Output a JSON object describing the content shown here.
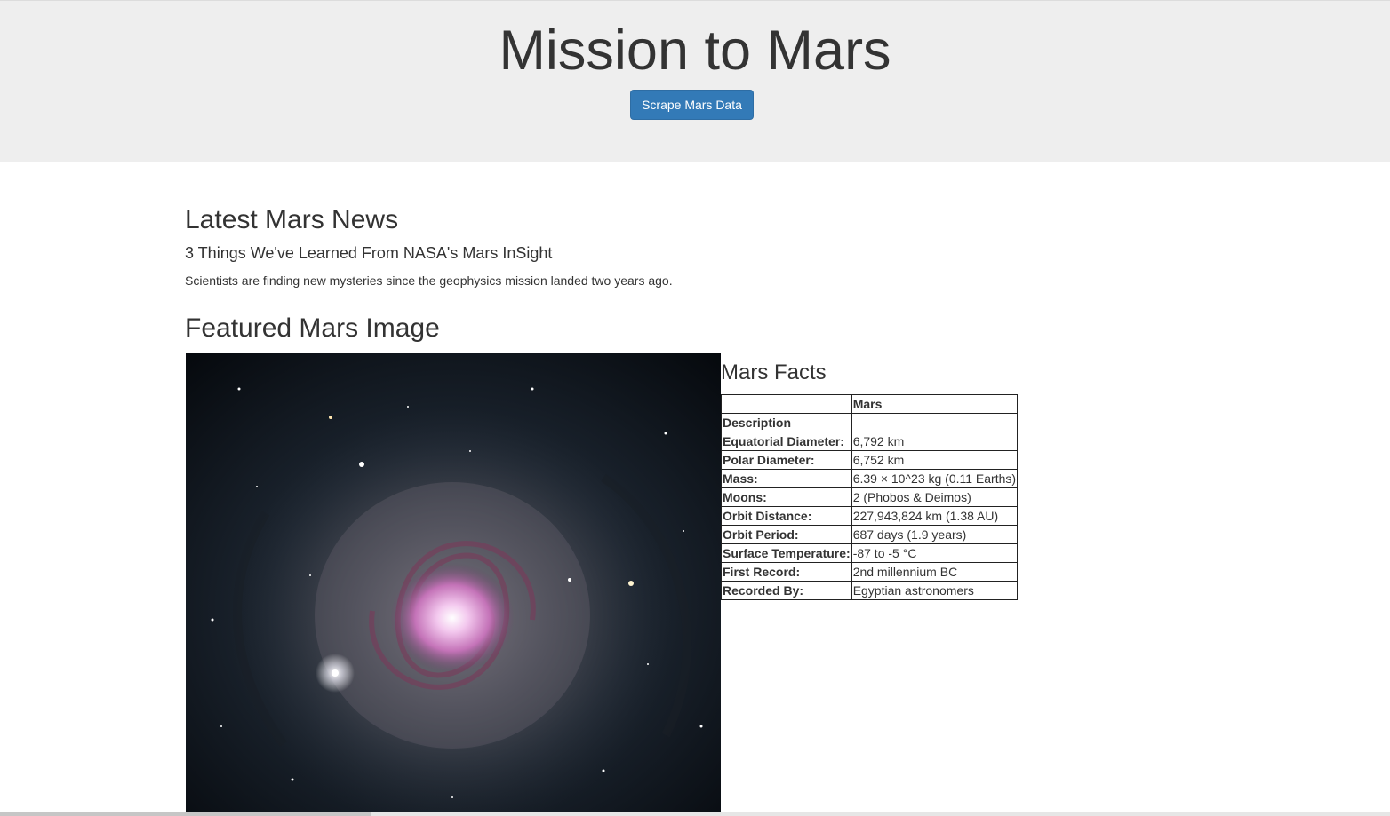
{
  "header": {
    "title": "Mission to Mars",
    "scrape_button_label": "Scrape Mars Data"
  },
  "news": {
    "heading": "Latest Mars News",
    "title": "3 Things We've Learned From NASA's Mars InSight",
    "paragraph": "Scientists are finding new mysteries since the geophysics mission landed two years ago."
  },
  "featured": {
    "heading": "Featured Mars Image",
    "image_icon": "galaxy-image"
  },
  "facts": {
    "heading": "Mars Facts",
    "columns": [
      "",
      "Mars"
    ],
    "rows": [
      {
        "label": "Description",
        "value": ""
      },
      {
        "label": "Equatorial Diameter:",
        "value": "6,792 km"
      },
      {
        "label": "Polar Diameter:",
        "value": "6,752 km"
      },
      {
        "label": "Mass:",
        "value": "6.39 × 10^23 kg (0.11 Earths)"
      },
      {
        "label": "Moons:",
        "value": "2 (Phobos & Deimos)"
      },
      {
        "label": "Orbit Distance:",
        "value": "227,943,824 km (1.38 AU)"
      },
      {
        "label": "Orbit Period:",
        "value": "687 days (1.9 years)"
      },
      {
        "label": "Surface Temperature:",
        "value": "-87 to -5 °C"
      },
      {
        "label": "First Record:",
        "value": "2nd millennium BC"
      },
      {
        "label": "Recorded By:",
        "value": "Egyptian astronomers"
      }
    ]
  },
  "colors": {
    "jumbotron_bg": "#eeeeee",
    "button_bg": "#337ab7",
    "text": "#333333"
  }
}
